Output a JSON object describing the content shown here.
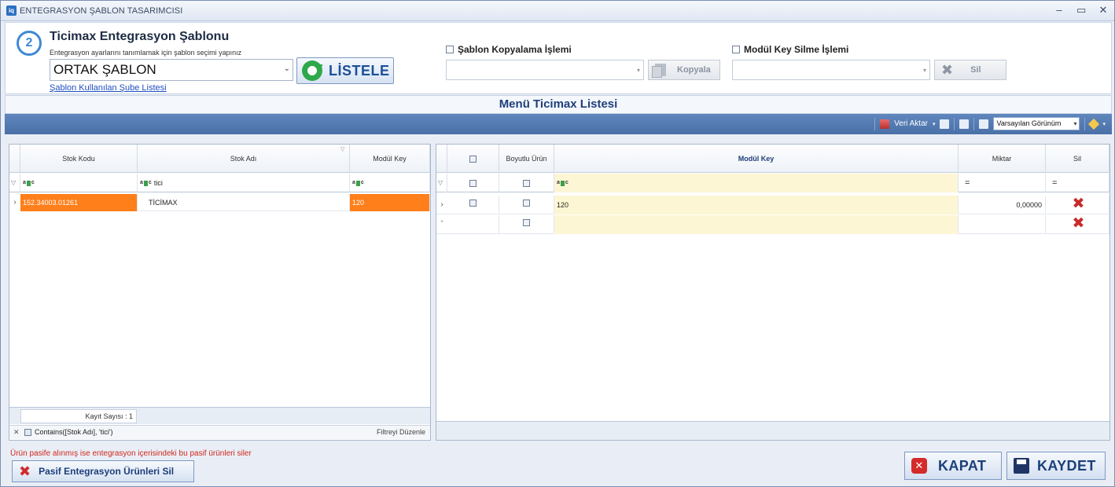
{
  "window": {
    "title": "ENTEGRASYON ŞABLON TASARIMCISI",
    "app_icon": "iq",
    "minimize": "–",
    "maximize": "▭",
    "close": "✕"
  },
  "header": {
    "step": "2",
    "title": "Ticimax Entegrasyon Şablonu",
    "subtitle": "Entegrasyon ayarlarını tanımlamak için şablon seçimi yapınız",
    "template_value": "ORTAK ŞABLON",
    "list_button": "LİSTELE",
    "branch_link": "Şablon Kullanılan Şube Listesi"
  },
  "copy": {
    "label": "Şablon Kopyalama İşlemi",
    "button": "Kopyala"
  },
  "delete_key": {
    "label": "Modül Key Silme İşlemi",
    "button": "Sil"
  },
  "list_title": "Menü Ticimax Listesi",
  "toolbar": {
    "export": "Veri Aktar",
    "view": "Varsayılan Görünüm"
  },
  "left_grid": {
    "columns": [
      "Stok Kodu",
      "Stok Adı",
      "Modül Key"
    ],
    "filter": [
      "",
      "tici",
      ""
    ],
    "rows": [
      {
        "stok_kodu": "152.34003.01261",
        "stok_adi": "TİCİMAX",
        "modul_key": "120"
      }
    ],
    "count_label": "Kayıt Sayısı : 1",
    "filter_text": "Contains([Stok Adı], 'tici')",
    "filter_edit": "Filtreyi Düzenle"
  },
  "right_grid": {
    "columns": [
      "",
      "Boyutlu Ürün",
      "Modül Key",
      "Miktar",
      "Sil"
    ],
    "filter_eq": "=",
    "rows": [
      {
        "modul_key": "120",
        "miktar": "0,00000"
      }
    ]
  },
  "footer": {
    "warning": "Ürün pasife alınmış ise entegrasyon içerisindeki bu pasif ürünleri siler",
    "passive_button": "Pasif Entegrasyon Ürünleri Sil",
    "close_button": "KAPAT",
    "save_button": "KAYDET"
  },
  "colors": {
    "accent": "#4a70a8",
    "selected_row": "#ff7f1a",
    "delete": "#c92a2a"
  }
}
